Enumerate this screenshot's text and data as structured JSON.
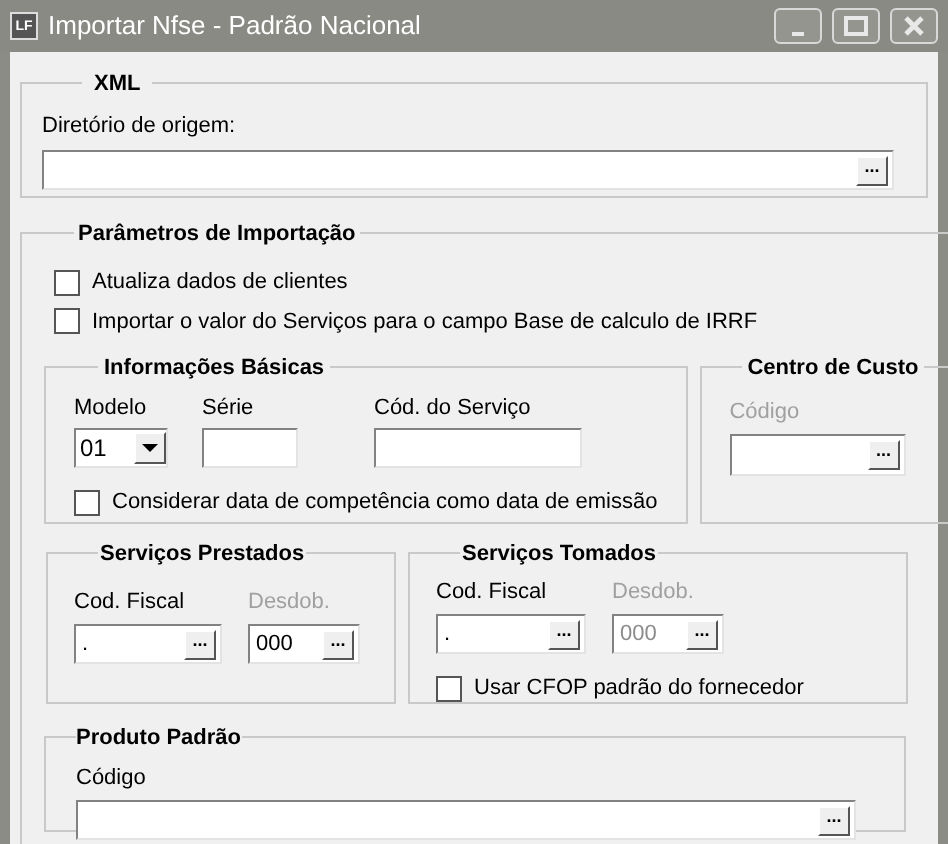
{
  "window": {
    "title": "Importar Nfse - Padrão Nacional",
    "icon_text": "LF"
  },
  "xml": {
    "title": "XML",
    "directory": {
      "label": "Diretório de origem:",
      "button": "..."
    }
  },
  "params": {
    "title": "Parâmetros de Importação",
    "checkboxes": [
      {
        "label": "Atualiza dados de clientes",
        "checked": false
      },
      {
        "label": "Importar o valor do Serviços para o campo Base de calculo de IRRF",
        "checked": false
      }
    ],
    "basic": {
      "title": "Informações Básicas",
      "model": {
        "label": "Modelo",
        "value": "01"
      },
      "series": {
        "label": "Série"
      },
      "service_code": {
        "label": "Cód. do Serviço"
      },
      "checkbox": {
        "label": "Considerar data de competência como data de emissão",
        "checked": false
      }
    },
    "cost_center": {
      "title": "Centro de Custo",
      "code": {
        "label": "Código",
        "label_disabled": true,
        "button": "..."
      }
    },
    "provided": {
      "title": "Serviços Prestados",
      "fiscal": {
        "label": "Cod. Fiscal",
        "label_disabled": false,
        "value": ".",
        "button": "...",
        "disabled": false
      },
      "split": {
        "label": "Desdob.",
        "label_disabled": true,
        "value": "000",
        "button": "...",
        "disabled": false
      }
    },
    "taken": {
      "title": "Serviços Tomados",
      "fiscal": {
        "label": "Cod. Fiscal",
        "label_disabled": false,
        "value": ".",
        "button": "...",
        "disabled": false
      },
      "split": {
        "label": "Desdob.",
        "label_disabled": true,
        "value": "000",
        "button": "...",
        "disabled": true
      },
      "checkbox": {
        "label": "Usar CFOP padrão do fornecedor",
        "checked": false
      }
    },
    "product": {
      "title": "Produto Padrão",
      "code": {
        "label": "Código",
        "button": "..."
      }
    }
  }
}
